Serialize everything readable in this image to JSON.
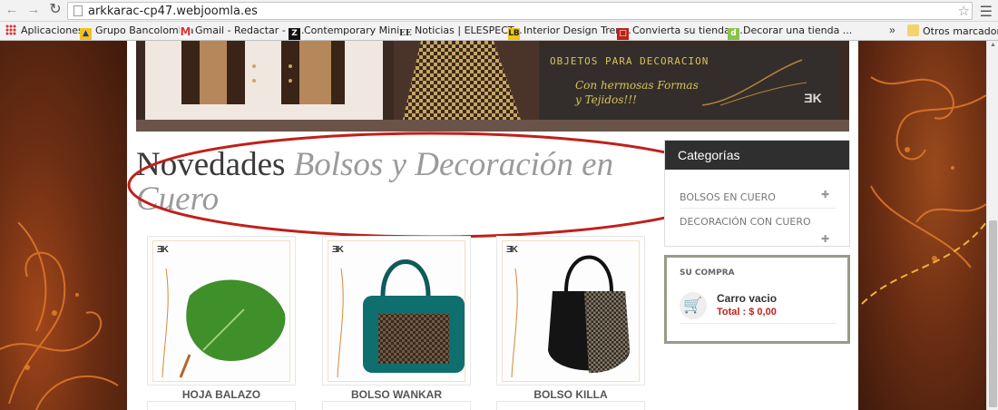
{
  "browser": {
    "url": "arkkarac-cp47.webjoomla.es",
    "bookmarks": [
      {
        "label": "Aplicaciones",
        "icon": "apps-grid-icon"
      },
      {
        "label": "Grupo Bancolombia",
        "icon": "bancolombia-icon"
      },
      {
        "label": "Gmail - Redactar - a...",
        "icon": "gmail-icon"
      },
      {
        "label": "Contemporary Mini...",
        "icon": "z-icon"
      },
      {
        "label": "Noticias | ELESPECT...",
        "icon": "ee-icon"
      },
      {
        "label": "Interior Design Tren...",
        "icon": "lb-icon"
      },
      {
        "label": "Convierta su tienda ...",
        "icon": "store-icon"
      },
      {
        "label": "Decorar una tienda ...",
        "icon": "d-icon"
      }
    ],
    "more_bookmarks_label": "»",
    "other_bookmarks": "Otros marcadores"
  },
  "banner": {
    "line1": "OBJETOS PARA DECORACION",
    "line2": "Con hermosas Formas",
    "line3": "y Tejidos!!!",
    "logo": "ƎK"
  },
  "heading": {
    "strong": "Novedades",
    "em": "Bolsos y Decoración en Cuero"
  },
  "products": [
    {
      "name": "HOJA BALAZO",
      "logo": "ƎK"
    },
    {
      "name": "BOLSO WANKAR",
      "logo": "ƎK"
    },
    {
      "name": "BOLSO KILLA",
      "logo": "ƎK"
    }
  ],
  "categories": {
    "title": "Categorías",
    "items": [
      {
        "label": "BOLSOS EN CUERO"
      },
      {
        "label": "DECORACIÓN CON CUERO"
      }
    ]
  },
  "cart": {
    "title": "SU COMPRA",
    "empty_label": "Carro vacio",
    "total_label": "Total : $ 0,00"
  },
  "colors": {
    "accent_red": "#c0201a",
    "highlight_ellipse": "#c0201a",
    "banner_gold": "#d8c25a",
    "page_bg": "#5a2a14"
  }
}
